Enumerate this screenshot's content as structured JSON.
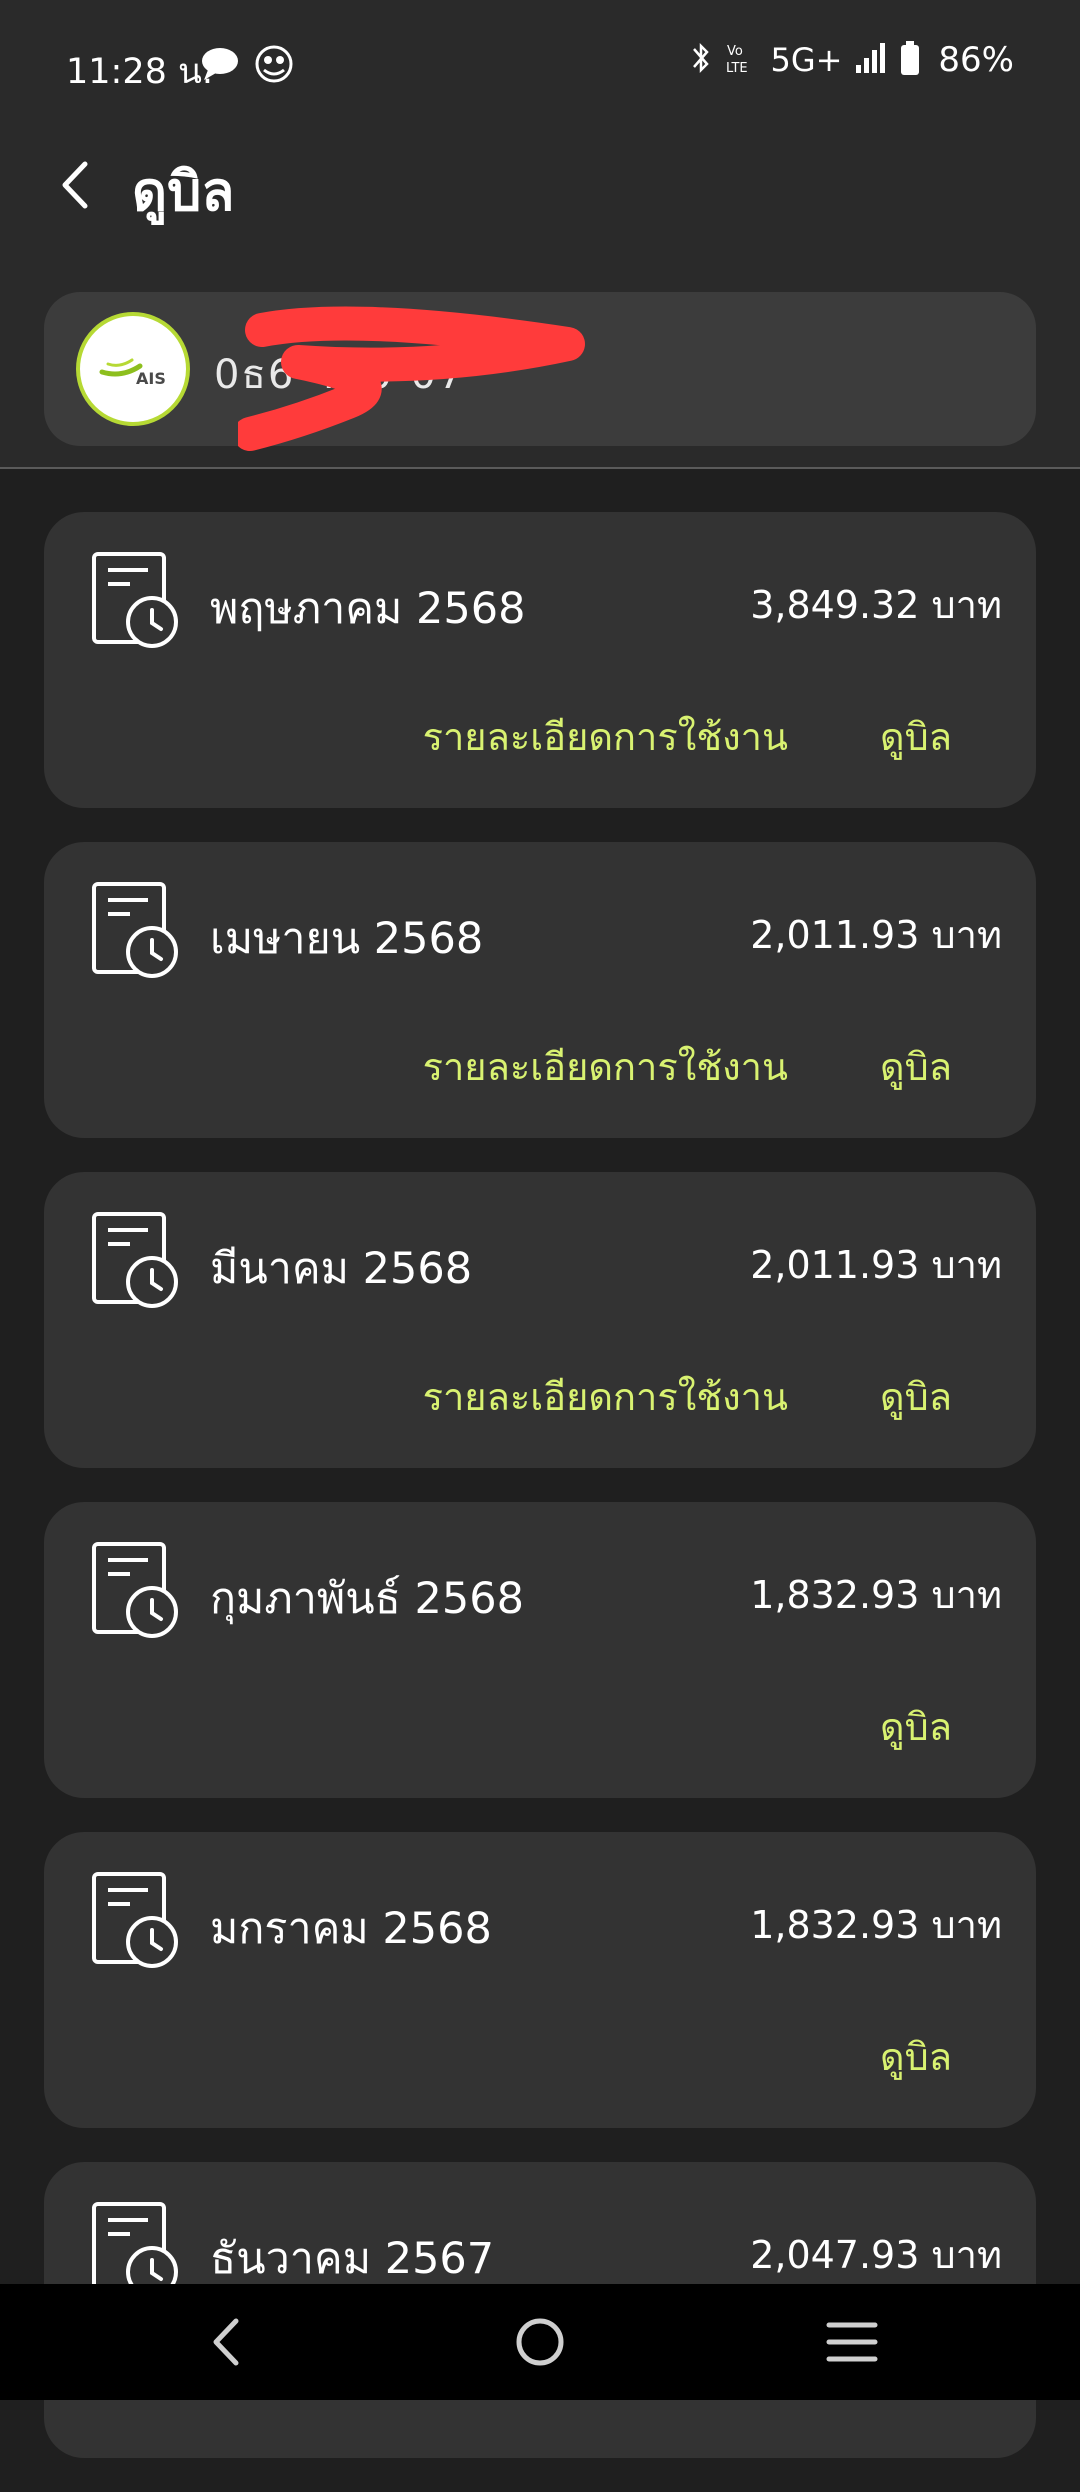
{
  "status_bar": {
    "time": "11:28 น.",
    "network": "5G+",
    "battery": "86%"
  },
  "header": {
    "title": "ดูบิล"
  },
  "account": {
    "logo_text": "AIS",
    "number_partial": "0ธ6-400-07"
  },
  "bills": [
    {
      "month": "พฤษภาคม 2568",
      "amount": "3,849.32 บาท",
      "usage_label": "รายละเอียดการใช้งาน",
      "view_label": "ดูบิล"
    },
    {
      "month": "เมษายน 2568",
      "amount": "2,011.93 บาท",
      "usage_label": "รายละเอียดการใช้งาน",
      "view_label": "ดูบิล"
    },
    {
      "month": "มีนาคม 2568",
      "amount": "2,011.93 บาท",
      "usage_label": "รายละเอียดการใช้งาน",
      "view_label": "ดูบิล"
    },
    {
      "month": "กุมภาพันธ์ 2568",
      "amount": "1,832.93 บาท",
      "view_label": "ดูบิล"
    },
    {
      "month": "มกราคม 2568",
      "amount": "1,832.93 บาท",
      "view_label": "ดูบิล"
    },
    {
      "month": "ธันวาคม 2567",
      "amount": "2,047.93 บาท"
    }
  ],
  "icons": {
    "back": "chevron-left-icon",
    "bill": "bill-history-icon",
    "nav_back": "nav-back-icon",
    "nav_home": "nav-home-icon",
    "nav_recents": "nav-recents-icon"
  },
  "colors": {
    "accent_link": "#d9f271",
    "card": "#333333",
    "background": "#1f1f1f",
    "redaction": "#ff3b3b"
  }
}
